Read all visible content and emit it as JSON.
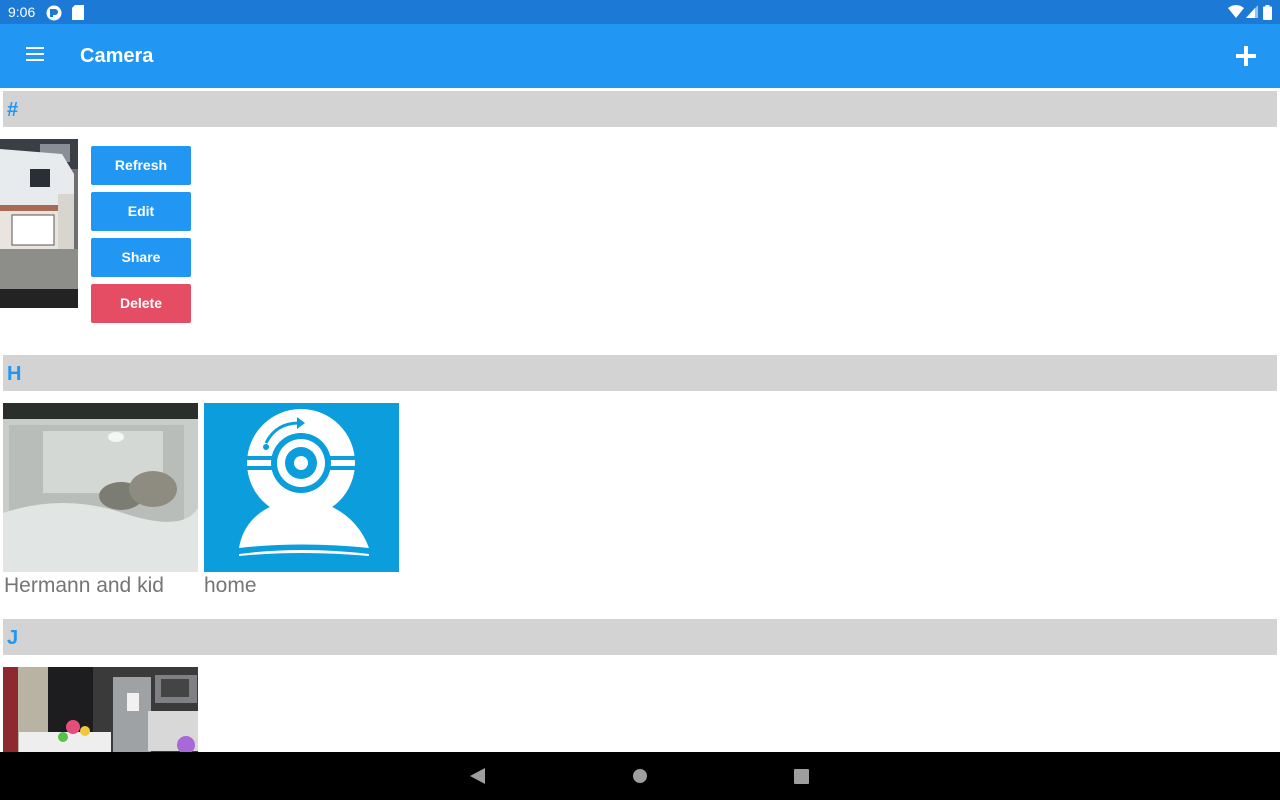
{
  "status_bar": {
    "time": "9:06",
    "left_icons": [
      "notification-app-icon",
      "sd-card-icon"
    ],
    "right_icons": [
      "wifi-icon",
      "cell-signal-icon",
      "battery-icon"
    ]
  },
  "app_bar": {
    "menu_icon": "hamburger-menu-icon",
    "title": "Camera",
    "add_icon": "plus-icon"
  },
  "sections": [
    {
      "letter": "#",
      "cameras": [
        {
          "name": "",
          "thumbnail": "van-and-gate-snapshot",
          "selected": true
        }
      ],
      "actions": [
        {
          "label": "Refresh",
          "color": "#2196f3"
        },
        {
          "label": "Edit",
          "color": "#2196f3"
        },
        {
          "label": "Share",
          "color": "#2196f3"
        },
        {
          "label": "Delete",
          "color": "#e54d64"
        }
      ]
    },
    {
      "letter": "H",
      "cameras": [
        {
          "name": "Hermann and kid",
          "thumbnail": "tortoise-night-snapshot"
        },
        {
          "name": "home",
          "thumbnail": "webcam-placeholder-icon"
        }
      ]
    },
    {
      "letter": "J",
      "cameras": [
        {
          "name": "",
          "thumbnail": "kitchen-snapshot"
        }
      ]
    }
  ],
  "nav_bar": {
    "buttons": [
      "back-icon",
      "home-icon",
      "recents-icon"
    ]
  },
  "colors": {
    "primary": "#2196f3",
    "status_bar": "#1c7ad6",
    "danger": "#e54d64",
    "section_bg": "#d3d3d3",
    "placeholder_bg": "#0b9ddc"
  }
}
